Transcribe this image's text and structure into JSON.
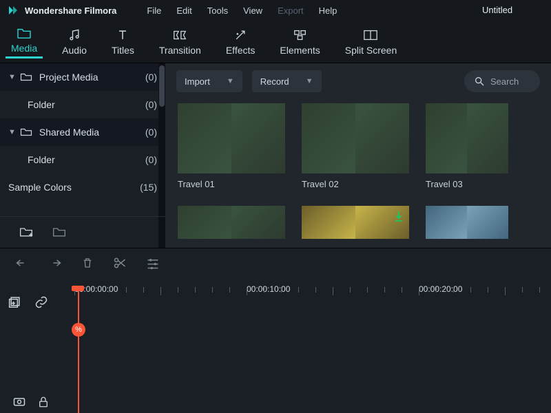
{
  "app_name": "Wondershare Filmora",
  "project_title": "Untitled",
  "menu": {
    "file": "File",
    "edit": "Edit",
    "tools": "Tools",
    "view": "View",
    "export": "Export",
    "help": "Help"
  },
  "tabs": {
    "media": "Media",
    "audio": "Audio",
    "titles": "Titles",
    "transition": "Transition",
    "effects": "Effects",
    "elements": "Elements",
    "split": "Split Screen"
  },
  "sidebar": {
    "project_media": {
      "label": "Project Media",
      "count": "(0)"
    },
    "project_folder": {
      "label": "Folder",
      "count": "(0)"
    },
    "shared_media": {
      "label": "Shared Media",
      "count": "(0)"
    },
    "shared_folder": {
      "label": "Folder",
      "count": "(0)"
    },
    "sample_colors": {
      "label": "Sample Colors",
      "count": "(15)"
    }
  },
  "gallery": {
    "import": "Import",
    "record": "Record",
    "search_placeholder": "Search",
    "cards": {
      "t1": "Travel 01",
      "t2": "Travel 02",
      "t3": "Travel 03"
    }
  },
  "timeline": {
    "ticks": {
      "t0": "00:00:00:00",
      "t1": "00:00:10:00",
      "t2": "00:00:20:00"
    }
  },
  "colors": {
    "accent": "#2dd4cf",
    "playhead": "#f85536"
  }
}
